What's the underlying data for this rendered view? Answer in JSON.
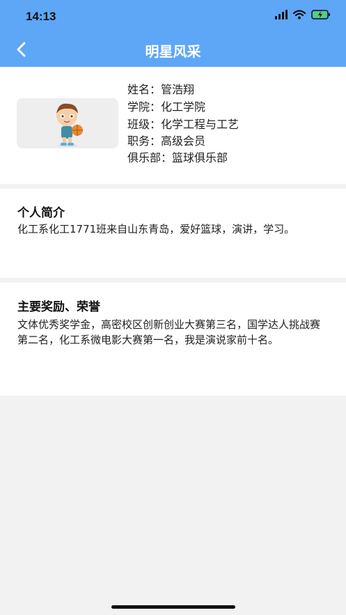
{
  "status_bar": {
    "time": "14:13"
  },
  "nav": {
    "title": "明星风采",
    "back_icon": "chevron-left-icon"
  },
  "profile": {
    "avatar_icon": "cartoon-boy-basketball-avatar",
    "fields": [
      {
        "label": "姓名：",
        "value": "管浩翔"
      },
      {
        "label": "学院：",
        "value": "化工学院"
      },
      {
        "label": "班级：",
        "value": "化学工程与工艺"
      },
      {
        "label": "职务：",
        "value": "高级会员"
      },
      {
        "label": "俱乐部：",
        "value": "篮球俱乐部"
      }
    ]
  },
  "intro": {
    "title": "个人简介",
    "body": "化工系化工1771班来自山东青岛，爱好篮球，演讲，学习。"
  },
  "awards": {
    "title": "主要奖励、荣誉",
    "body": "文体优秀奖学金，高密校区创新创业大赛第三名，国学达人挑战赛第二名，化工系微电影大赛第一名，我是演说家前十名。"
  },
  "colors": {
    "header": "#5ea6f6",
    "background": "#f2f2f2",
    "battery": "#4cd964"
  }
}
